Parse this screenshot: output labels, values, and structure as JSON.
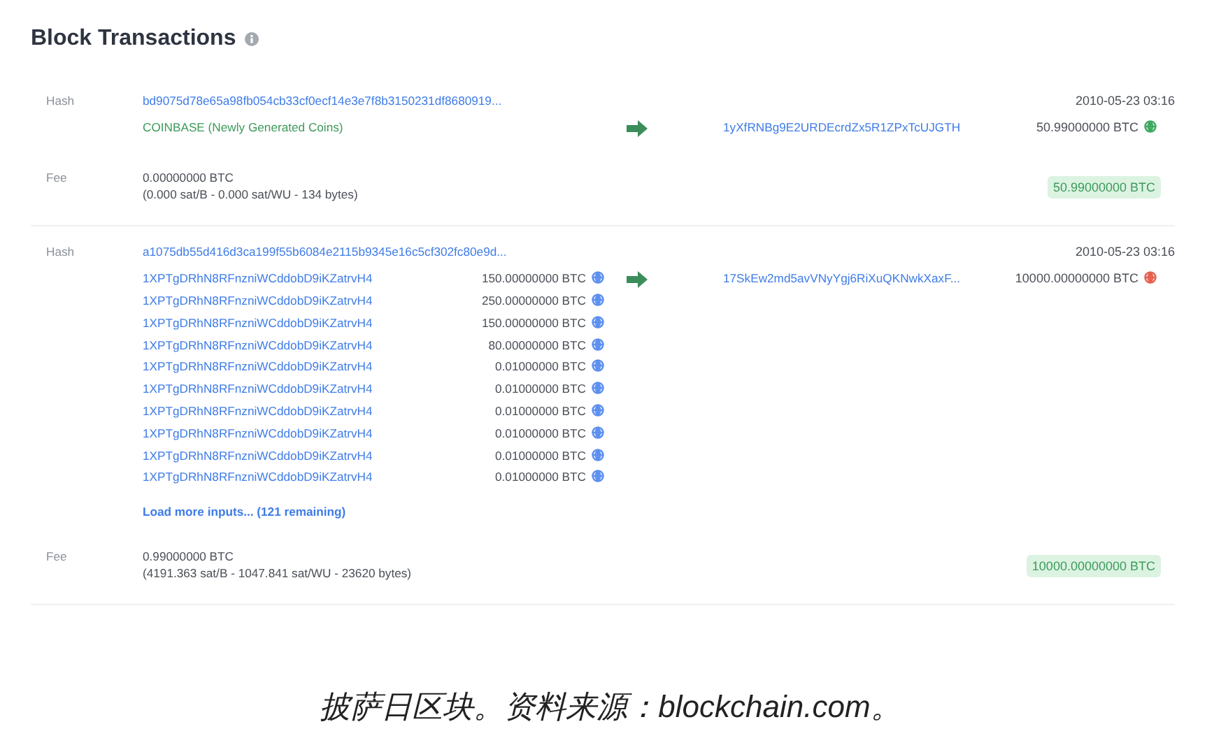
{
  "header": {
    "title": "Block Transactions"
  },
  "transactions": [
    {
      "hash_label": "Hash",
      "hash": "bd9075d78e65a98fb054cb33cf0ecf14e3e7f8b3150231df8680919...",
      "time": "2010-05-23 03:16",
      "inputs": [
        {
          "kind": "coinbase",
          "text": "COINBASE (Newly Generated Coins)"
        }
      ],
      "outputs": [
        {
          "address": "1yXfRNBg9E2URDEcrdZx5R1ZPxTcUJGTH",
          "amount": "50.99000000 BTC",
          "spent": false
        }
      ],
      "fee_label": "Fee",
      "fee": "0.00000000 BTC",
      "fee_detail": "(0.000 sat/B - 0.000 sat/WU - 134 bytes)",
      "total": "50.99000000 BTC"
    },
    {
      "hash_label": "Hash",
      "hash": "a1075db55d416d3ca199f55b6084e2115b9345e16c5cf302fc80e9d...",
      "time": "2010-05-23 03:16",
      "inputs": [
        {
          "kind": "address",
          "address": "1XPTgDRhN8RFnzniWCddobD9iKZatrvH4",
          "amount": "150.00000000 BTC"
        },
        {
          "kind": "address",
          "address": "1XPTgDRhN8RFnzniWCddobD9iKZatrvH4",
          "amount": "250.00000000 BTC"
        },
        {
          "kind": "address",
          "address": "1XPTgDRhN8RFnzniWCddobD9iKZatrvH4",
          "amount": "150.00000000 BTC"
        },
        {
          "kind": "address",
          "address": "1XPTgDRhN8RFnzniWCddobD9iKZatrvH4",
          "amount": "80.00000000 BTC"
        },
        {
          "kind": "address",
          "address": "1XPTgDRhN8RFnzniWCddobD9iKZatrvH4",
          "amount": "0.01000000 BTC"
        },
        {
          "kind": "address",
          "address": "1XPTgDRhN8RFnzniWCddobD9iKZatrvH4",
          "amount": "0.01000000 BTC"
        },
        {
          "kind": "address",
          "address": "1XPTgDRhN8RFnzniWCddobD9iKZatrvH4",
          "amount": "0.01000000 BTC"
        },
        {
          "kind": "address",
          "address": "1XPTgDRhN8RFnzniWCddobD9iKZatrvH4",
          "amount": "0.01000000 BTC"
        },
        {
          "kind": "address",
          "address": "1XPTgDRhN8RFnzniWCddobD9iKZatrvH4",
          "amount": "0.01000000 BTC"
        },
        {
          "kind": "address",
          "address": "1XPTgDRhN8RFnzniWCddobD9iKZatrvH4",
          "amount": "0.01000000 BTC"
        }
      ],
      "load_more": "Load more inputs... (121 remaining)",
      "outputs": [
        {
          "address": "17SkEw2md5avVNyYgj6RiXuQKNwkXaxF...",
          "amount": "10000.00000000 BTC",
          "spent": true
        }
      ],
      "fee_label": "Fee",
      "fee": "0.99000000 BTC",
      "fee_detail": "(4191.363 sat/B - 1047.841 sat/WU - 23620 bytes)",
      "total": "10000.00000000 BTC"
    }
  ],
  "caption": "披萨日区块。资料来源：blockchain.com。"
}
